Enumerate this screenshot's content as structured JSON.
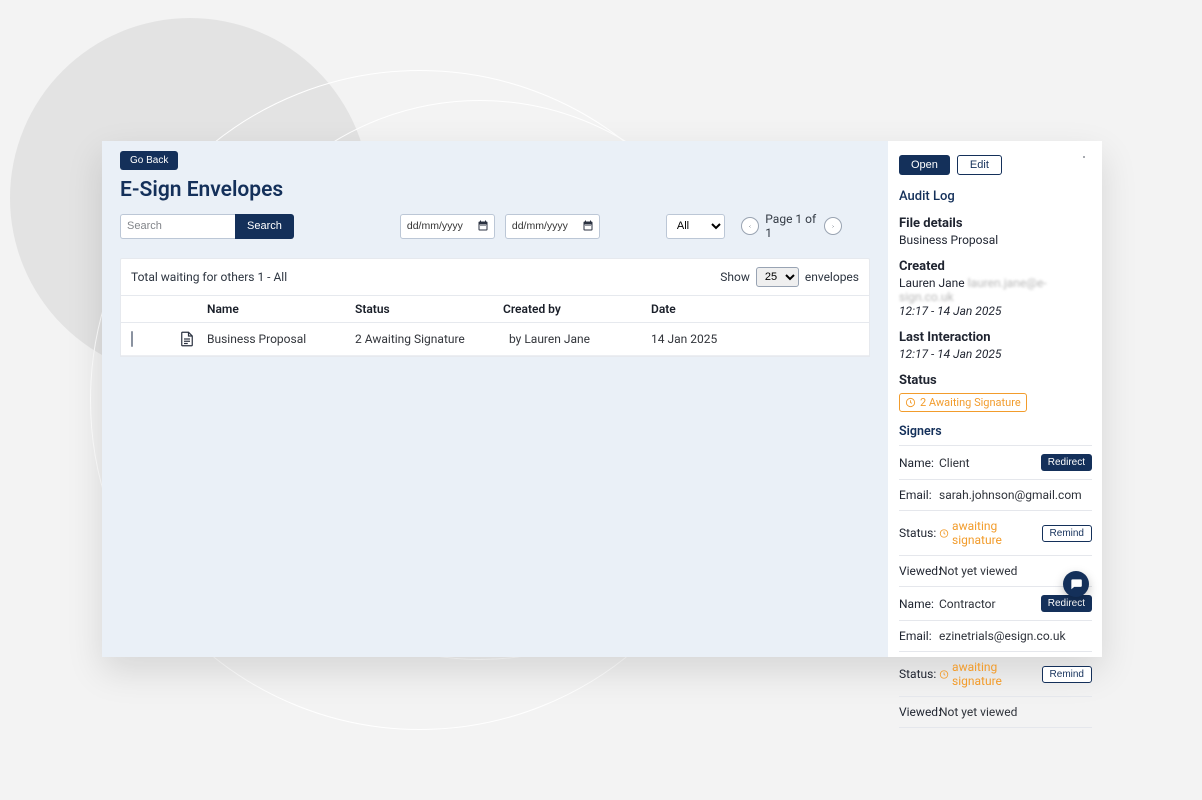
{
  "main": {
    "go_back": "Go Back",
    "page_title": "E-Sign Envelopes",
    "search_placeholder": "Search",
    "search_button": "Search",
    "date_from": "dd/mm/yyyy",
    "date_to": "dd/mm/yyyy",
    "filter_all": "All",
    "paging_label": "Page 1 of 1",
    "summary_text": "Total waiting for others 1 - All",
    "show_label": "Show",
    "perpage_value": "25",
    "envelopes_label": "envelopes",
    "columns": {
      "name": "Name",
      "status": "Status",
      "created_by": "Created by",
      "date": "Date"
    },
    "rows": [
      {
        "name": "Business Proposal",
        "status": "2 Awaiting Signature",
        "created_by": "by Lauren Jane",
        "date": "14 Jan 2025"
      }
    ]
  },
  "detail": {
    "open": "Open",
    "edit": "Edit",
    "audit_log": "Audit Log",
    "file_details_label": "File details",
    "file_details_name": "Business Proposal",
    "created_label": "Created",
    "created_name": "Lauren Jane",
    "created_email": "lauren.jane@e-sign.co.uk",
    "created_time": "12:17 - 14 Jan 2025",
    "last_interaction_label": "Last Interaction",
    "last_interaction_time": "12:17 - 14 Jan 2025",
    "status_label": "Status",
    "status_text": "2 Awaiting Signature",
    "signers_header": "Signers",
    "labels": {
      "name": "Name:",
      "email": "Email:",
      "status": "Status:",
      "viewed": "Viewed:"
    },
    "signers": [
      {
        "name": "Client",
        "email": "sarah.johnson@gmail.com",
        "status": "awaiting signature",
        "viewed": "Not yet viewed"
      },
      {
        "name": "Contractor",
        "email": "ezinetrials@esign.co.uk",
        "status": "awaiting signature",
        "viewed": "Not yet viewed"
      }
    ],
    "redirect": "Redirect",
    "remind": "Remind"
  }
}
